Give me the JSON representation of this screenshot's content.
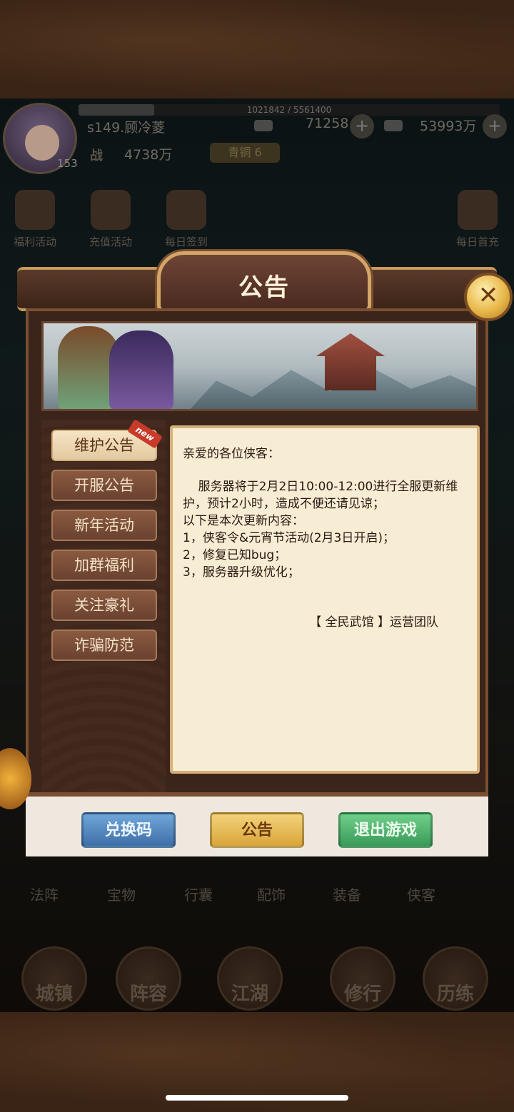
{
  "hud": {
    "exp_text": "1021842 / 5561400",
    "exp_fraction": 0.18,
    "player_name": "s149.顾冷菱",
    "level": "153",
    "silver": "71258",
    "gold": "53993万",
    "power_label": "战",
    "power": "4738万",
    "rank": "青铜 6"
  },
  "quick_actions": [
    "福利活动",
    "充值活动",
    "每日签到",
    "每日首充"
  ],
  "bottom_tabs": [
    "法阵",
    "宝物",
    "行囊",
    "配饰",
    "装备",
    "侠客"
  ],
  "bottom_nav": [
    "城镇",
    "阵容",
    "江湖",
    "修行",
    "历练"
  ],
  "dialog": {
    "title": "公告",
    "close_glyph": "✕",
    "tabs": [
      {
        "label": "维护公告",
        "active": true,
        "badge": "new"
      },
      {
        "label": "开服公告"
      },
      {
        "label": "新年活动"
      },
      {
        "label": "加群福利"
      },
      {
        "label": "关注豪礼"
      },
      {
        "label": "诈骗防范"
      }
    ],
    "content": {
      "greeting": "亲爱的各位侠客：",
      "body": "    服务器将于2月2日10:00-12:00进行全服更新维护，预计2小时，造成不便还请见谅；\n以下是本次更新内容：\n1，侠客令&元宵节活动(2月3日开启)；\n2，修复已知bug；\n3，服务器升级优化；",
      "signature": "【 全民武馆 】运营团队"
    },
    "buttons": {
      "redeem": "兑换码",
      "notice": "公告",
      "exit": "退出游戏"
    }
  }
}
